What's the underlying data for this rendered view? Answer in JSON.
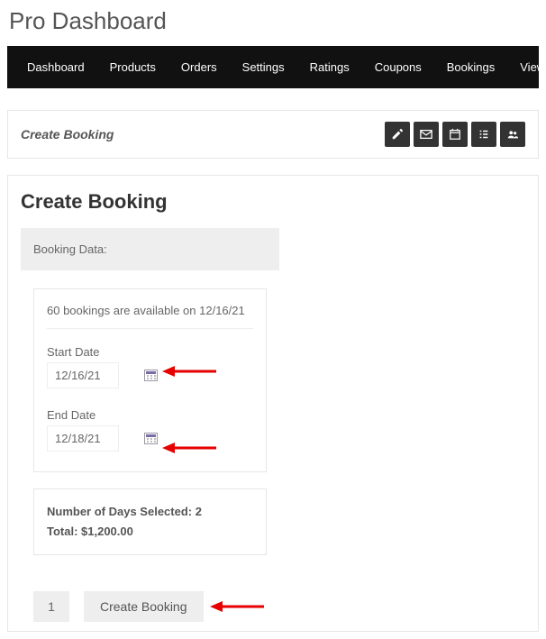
{
  "pageTitle": "Pro Dashboard",
  "nav": [
    "Dashboard",
    "Products",
    "Orders",
    "Settings",
    "Ratings",
    "Coupons",
    "Bookings",
    "View Store"
  ],
  "panel": {
    "title": "Create Booking",
    "icons": [
      "edit-icon",
      "mail-icon",
      "calendar-icon",
      "list-icon",
      "users-icon"
    ]
  },
  "main": {
    "title": "Create Booking",
    "sectionHeading": "Booking Data:",
    "availability": "60 bookings are available on 12/16/21",
    "startLabel": "Start Date",
    "startDate": "12/16/21",
    "endLabel": "End Date",
    "endDate": "12/18/21",
    "daysLine": "Number of Days Selected: 2",
    "totalLine": "Total: $1,200.00",
    "quantity": "1",
    "submitLabel": "Create Booking"
  }
}
